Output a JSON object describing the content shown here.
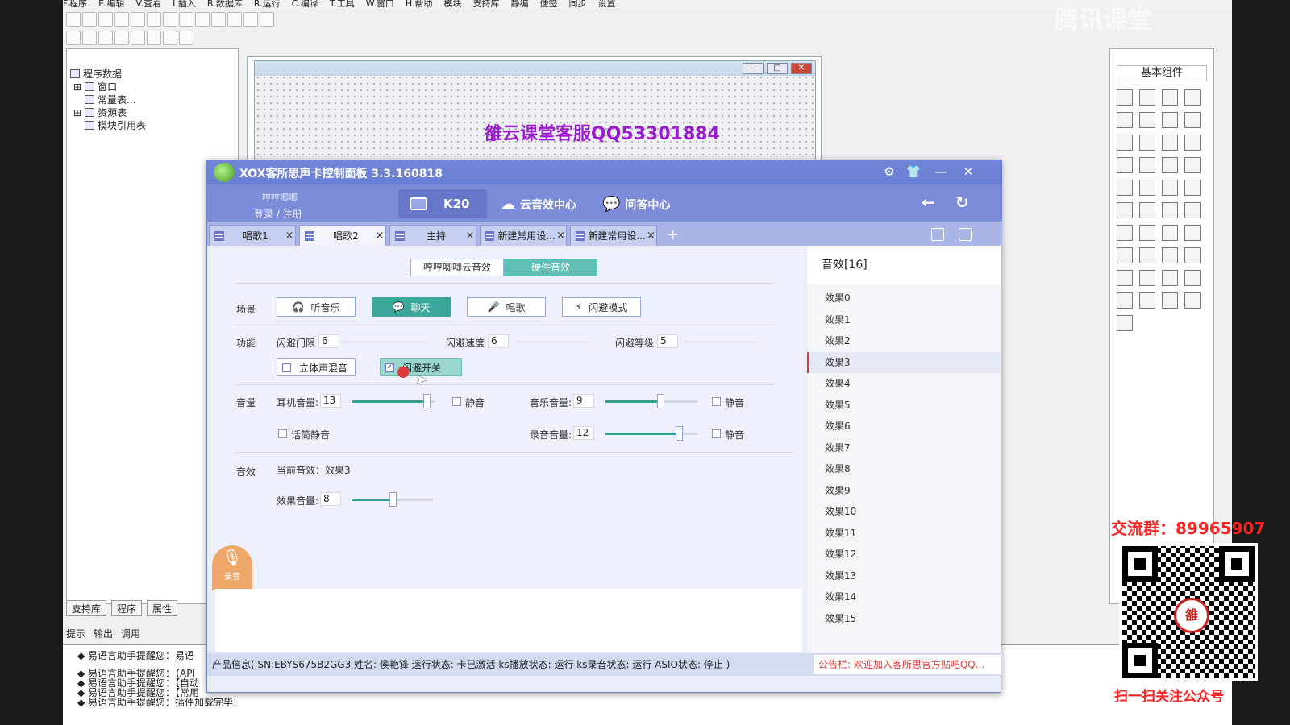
{
  "ide": {
    "menu": [
      "F.程序",
      "E.编辑",
      "V.查看",
      "I.插入",
      "B.数据库",
      "R.运行",
      "C.编译",
      "T.工具",
      "W.窗口",
      "H.帮助",
      "模块",
      "支持库",
      "静编",
      "便签",
      "同步",
      "设置"
    ],
    "tree": {
      "root": "程序数据",
      "items": [
        "窗口",
        "常量表...",
        "资源表",
        "模块引用表"
      ]
    },
    "bottom_tabs": [
      "支持库",
      "程序",
      "属性"
    ],
    "output_tabs": [
      "提示",
      "输出",
      "调用"
    ],
    "output_lines": [
      "◆ 易语言助手提醒您：易语",
      "◆ 易语言助手提醒您：【API",
      "◆ 易语言助手提醒您：【自动",
      "◆ 易语言助手提醒您：【常用",
      "◆ 易语言助手提醒您：插件加载完毕!"
    ],
    "designer_text": "雒云课堂客服QQ53301884",
    "window_buttons": [
      "—",
      "□",
      "✕"
    ],
    "right_panel_title": "基本组件",
    "watermark": "腾讯课堂"
  },
  "promo": {
    "group": "交流群：89965907",
    "qr_seal": "雒",
    "scan": "扫一扫关注公众号"
  },
  "app": {
    "title": "XOX客所思声卡控制面板  3.3.160818",
    "title_icons": [
      "⚙",
      "👕",
      "—",
      "✕"
    ],
    "user": "哼哼唧唧",
    "login": "登录  /  注册",
    "device": "K20",
    "nav": [
      {
        "icon": "☁",
        "label": "云音效中心"
      },
      {
        "icon": "💬",
        "label": "问答中心"
      }
    ],
    "nav_back": "←",
    "nav_refresh": "↻",
    "tabs": [
      "唱歌1",
      "唱歌2",
      "主持",
      "新建常用设...",
      "新建常用设..."
    ],
    "tab_close": "×",
    "tab_add": "+",
    "mode": [
      "哼哼唧唧云音效",
      "硬件音效"
    ],
    "labels": {
      "scene": "场景",
      "func": "功能",
      "volume": "音量",
      "effect": "音效"
    },
    "scenes": [
      {
        "icon": "🎧",
        "label": "听音乐"
      },
      {
        "icon": "💬",
        "label": "聊天"
      },
      {
        "icon": "🎤",
        "label": "唱歌"
      },
      {
        "icon": "⚡",
        "label": "闪避模式"
      }
    ],
    "func": {
      "threshold_label": "闪避门限",
      "threshold": "6",
      "speed_label": "闪避速度",
      "speed": "6",
      "level_label": "闪避等级",
      "level": "5",
      "stereo_label": "立体声混音",
      "dodge_label": "闪避开关",
      "dodge_check": "✓"
    },
    "volume": {
      "headphone_label": "耳机音量:",
      "headphone": "13",
      "headphone_level": 0.9,
      "music_label": "音乐音量:",
      "music": "9",
      "music_level": 0.6,
      "record_label": "录音音量:",
      "record": "12",
      "record_level": 0.8,
      "mute": "静音",
      "mic_mute": "话筒静音"
    },
    "effect": {
      "current": "当前音效：效果3",
      "volume_label": "效果音量:",
      "volume": "8",
      "volume_level": 0.5
    },
    "mic_button": {
      "icon": "🎙",
      "label": "录音"
    },
    "fx_title": "音效[16]",
    "fx_items": [
      "效果0",
      "效果1",
      "效果2",
      "效果3",
      "效果4",
      "效果5",
      "效果6",
      "效果7",
      "效果8",
      "效果9",
      "效果10",
      "效果11",
      "效果12",
      "效果13",
      "效果14",
      "效果15"
    ],
    "fx_selected": "效果3",
    "status": "产品信息( SN:EBYS675B2GG3  姓名: 侯艳锋  运行状态: 卡已激活  ks播放状态: 运行  ks录音状态: 运行  ASIO状态: 停止 )",
    "notice": "公告栏: 欢迎加入客所思官方贴吧QQ..."
  }
}
